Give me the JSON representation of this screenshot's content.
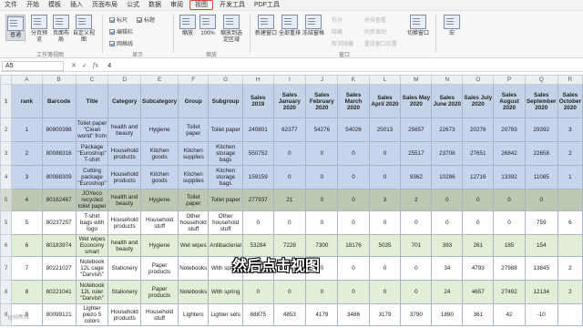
{
  "menu": [
    "文件",
    "开始",
    "模板",
    "插入",
    "页面布局",
    "公式",
    "数据",
    "审阅",
    "视图",
    "开发工具",
    "PDF工具"
  ],
  "menu_active_index": 8,
  "ribbon": {
    "view_modes": [
      "普通",
      "分页预览",
      "页面布局",
      "自定义视图"
    ],
    "workbook_views_label": "工作簿视图",
    "checkboxes": [
      {
        "label": "标尺",
        "checked": true
      },
      {
        "label": "编辑栏",
        "checked": true
      },
      {
        "label": "网格线",
        "checked": true
      },
      {
        "label": "标题",
        "checked": true
      }
    ],
    "show_label": "显示",
    "zoom_buttons": [
      "缩放",
      "100%",
      "缩放到选定区域"
    ],
    "zoom_label": "缩放",
    "window_buttons": [
      "新建窗口",
      "全部重排",
      "冻结窗格"
    ],
    "window_small": [
      "拆分",
      "隐藏",
      "取消隐藏",
      "并排查看",
      "同步滚动",
      "重设窗口位置"
    ],
    "window_label": "窗口",
    "switch_window": "切换窗口",
    "macro_label": "宏"
  },
  "formula_bar": {
    "cell": "A5",
    "value": "4",
    "icons": [
      "cancel-icon",
      "confirm-icon",
      "fx-icon"
    ]
  },
  "columns": [
    "A",
    "B",
    "C",
    "D",
    "E",
    "F",
    "G",
    "H",
    "I",
    "J",
    "K",
    "L",
    "M",
    "N",
    "O",
    "P",
    "Q",
    "R"
  ],
  "table": {
    "headers": [
      "rank",
      "Barcode",
      "Title",
      "Category",
      "Subcategory",
      "Group",
      "Subgroup",
      "Sales 2019",
      "Sales January 2020",
      "Sales February 2020",
      "Sales March 2020",
      "Sales April 2020",
      "Sales May 2020",
      "Sales June 2020",
      "Sales July 2020",
      "Sales August 2020",
      "Sales September 2020",
      "Sales October 2020"
    ],
    "rows": [
      {
        "num": "2",
        "style": "r-blue",
        "cells": [
          "1",
          "80800398",
          "Toilet paper \"Clean world\" from",
          "health and beauty",
          "Hygiene",
          "Toilet paper",
          "Toilet paper",
          "240801",
          "62377",
          "54276",
          "54026",
          "25013",
          "25657",
          "22673",
          "20276",
          "20793",
          "29392",
          "3"
        ]
      },
      {
        "num": "3",
        "style": "r-blue",
        "cells": [
          "2",
          "80088316",
          "Package \"Euroshop\" T-shirt",
          "Household products",
          "Kitchen goods",
          "Kitchen supplies",
          "Kitchen storage bags",
          "550752",
          "0",
          "0",
          "0",
          "0",
          "25517",
          "23708",
          "27651",
          "26842",
          "22658",
          "2"
        ]
      },
      {
        "num": "4",
        "style": "r-blue",
        "cells": [
          "3",
          "80088309",
          "Cutting package \"Euroshop\"",
          "Household products",
          "Kitchen goods",
          "Kitchen supplies",
          "Kitchen storage bags",
          "159159",
          "0",
          "0",
          "0",
          "0",
          "9362",
          "10286",
          "12716",
          "13392",
          "11085",
          "1"
        ]
      },
      {
        "num": "5",
        "style": "r-sel",
        "cells": [
          "4",
          "80162467",
          "JOYeco recycled toilet paper",
          "health and beauty",
          "Hygiene",
          "Toilet paper",
          "Toilet paper",
          "277937",
          "21",
          "0",
          "0",
          "3",
          "2",
          "0",
          "0",
          "0",
          "0",
          ""
        ]
      },
      {
        "num": "5",
        "style": "r-white",
        "cells": [
          "5",
          "80237257",
          "T-shirt bags with logo",
          "Household products",
          "Household stuff",
          "Other household stuff",
          "Other household stuff",
          "0",
          "0",
          "0",
          "0",
          "0",
          "0",
          "0",
          "0",
          "0",
          "759",
          "6"
        ]
      },
      {
        "num": "6",
        "style": "r-green",
        "cells": [
          "6",
          "80183974",
          "Wet wipes Economy smart",
          "health and beauty",
          "Hygiene",
          "Wet wipes",
          "Antibacterial",
          "53284",
          "7228",
          "7300",
          "18176",
          "5035",
          "701",
          "393",
          "261",
          "185",
          "154",
          ""
        ]
      },
      {
        "num": "7",
        "style": "r-white",
        "cells": [
          "7",
          "80221027",
          "Notebook 12L cage \"Darvish\"",
          "Stationery",
          "Paper products",
          "Notebooks",
          "With spring",
          "0",
          "0",
          "0",
          "0",
          "0",
          "0",
          "34",
          "4793",
          "27988",
          "13845",
          "2"
        ]
      },
      {
        "num": "8",
        "style": "r-green",
        "cells": [
          "8",
          "80221041",
          "Notebook 12L ruler \"Darvish\"",
          "Stationery",
          "Paper products",
          "Notebooks",
          "With spring",
          "0",
          "0",
          "0",
          "0",
          "0",
          "0",
          "24",
          "4657",
          "27492",
          "12134",
          "2"
        ]
      },
      {
        "num": "9",
        "style": "r-white",
        "cells": [
          "9",
          "80099121",
          "Lighter piezo 5 colors",
          "Household products",
          "Household stuff",
          "Lighters",
          "Lighter sets",
          "68875",
          "4853",
          "4179",
          "3486",
          "3179",
          "3790",
          "1890",
          "361",
          "42",
          "-10",
          ""
        ]
      }
    ]
  },
  "subtitle": "然后点击视图",
  "watermark": "视频教程"
}
